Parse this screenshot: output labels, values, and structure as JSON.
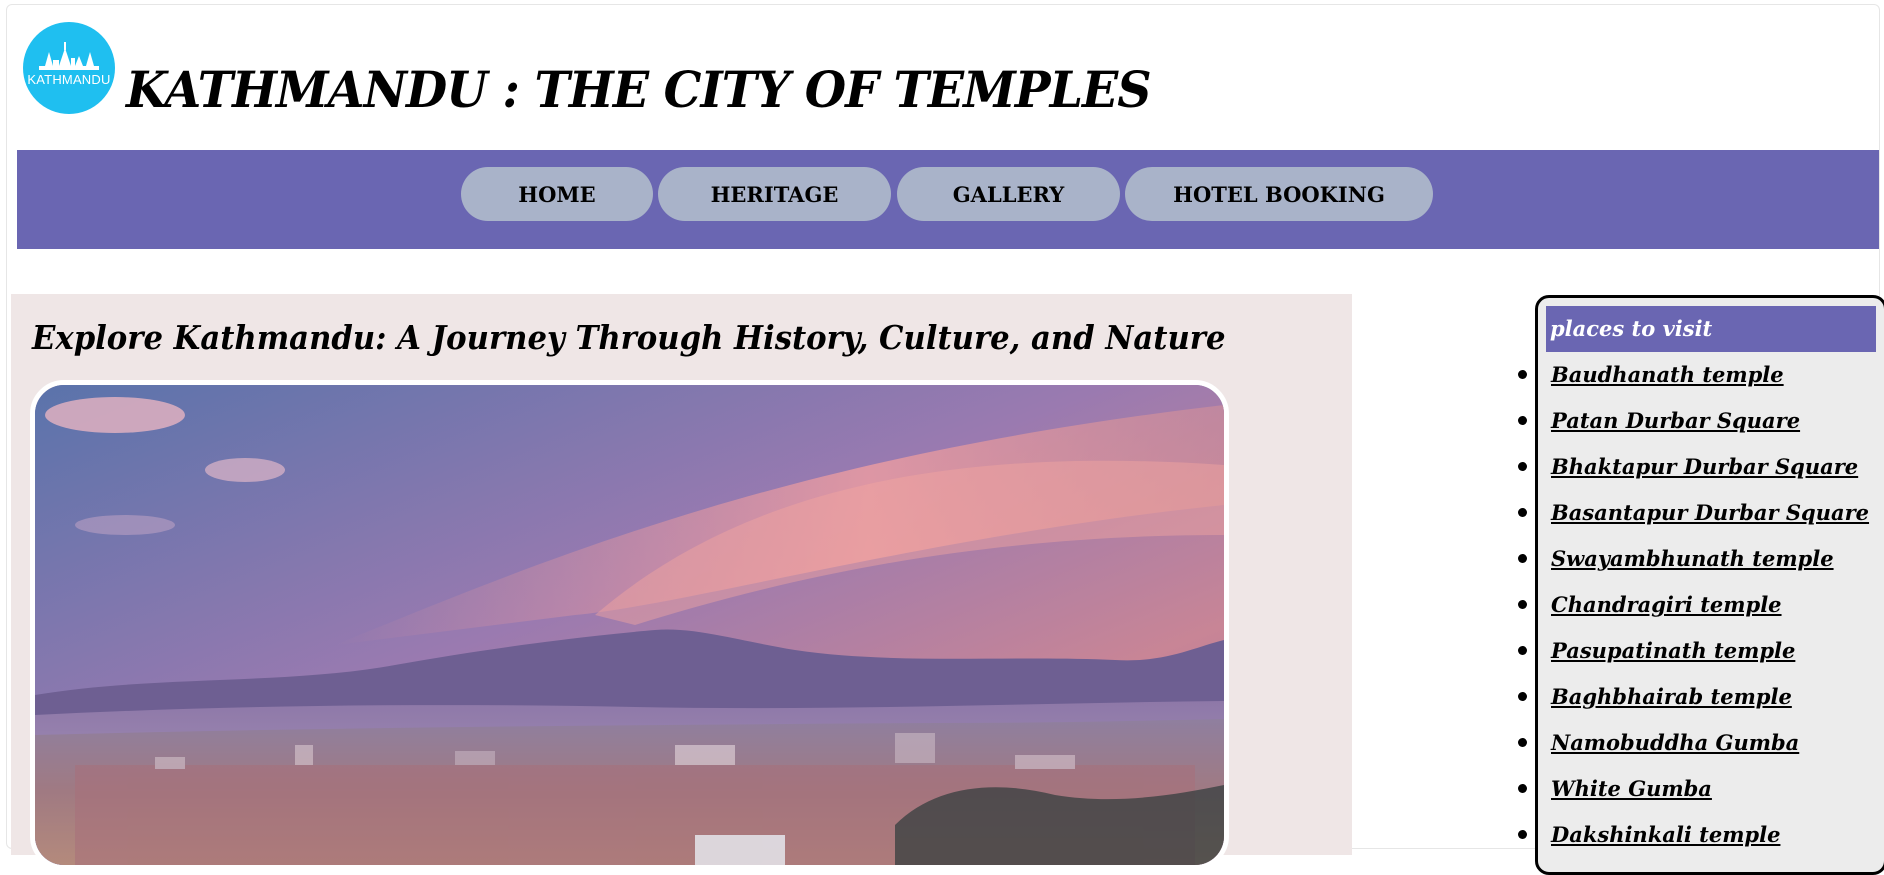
{
  "header": {
    "logo_text": "KATHMANDU",
    "title": "KATHMANDU : THE CITY OF TEMPLES"
  },
  "nav": {
    "items": [
      {
        "label": "HOME"
      },
      {
        "label": "HERITAGE"
      },
      {
        "label": "GALLERY"
      },
      {
        "label": "HOTEL BOOKING"
      }
    ]
  },
  "main": {
    "title": "Explore Kathmandu: A Journey Through History, Culture, and Nature",
    "hero_image": "kathmandu-city-sunset-skyline"
  },
  "sidebar": {
    "heading": "places to visit",
    "places": [
      "Baudhanath temple",
      "Patan Durbar Square",
      "Bhaktapur Durbar Square",
      "Basantapur Durbar Square",
      "Swayambhunath temple",
      "Chandragiri temple",
      "Pasupatinath temple",
      "Baghbhairab temple",
      "Namobuddha Gumba",
      "White Gumba",
      "Dakshinkali temple"
    ]
  },
  "colors": {
    "nav_bar": "#6a66b2",
    "nav_button": "#a9b3c9",
    "main_bg": "#efe6e6",
    "logo_bg": "#1fbff0"
  }
}
